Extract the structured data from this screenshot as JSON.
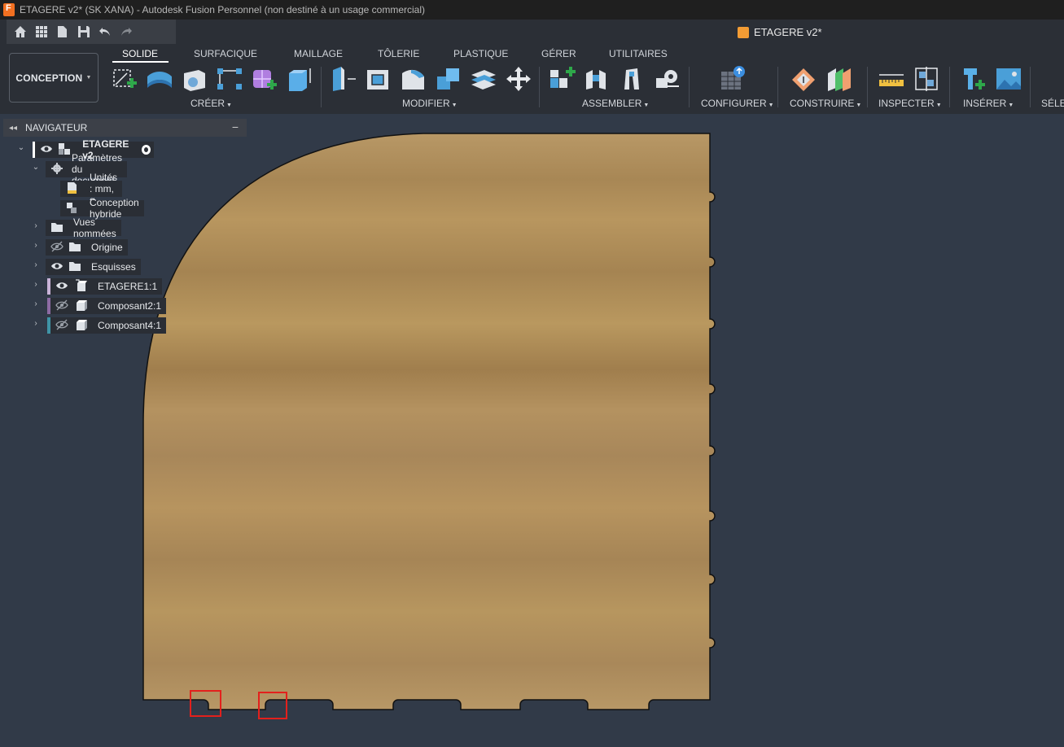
{
  "window": {
    "title": "ETAGERE v2* (SK XANA) - Autodesk Fusion Personnel (non destiné à un usage commercial)"
  },
  "document_tab": {
    "title": "ETAGERE v2*",
    "icon": "orange-cube-icon"
  },
  "workspace": {
    "label": "CONCEPTION"
  },
  "ribbon": {
    "tabs": [
      "SOLIDE",
      "SURFACIQUE",
      "MAILLAGE",
      "TÔLERIE",
      "PLASTIQUE",
      "GÉRER",
      "UTILITAIRES"
    ],
    "active_tab": "SOLIDE",
    "groups": [
      "CRÉER",
      "MODIFIER",
      "ASSEMBLER",
      "CONFIGURER",
      "CONSTRUIRE",
      "INSPECTER",
      "INSÉRER",
      "SÉLE"
    ]
  },
  "navigator": {
    "title": "NAVIGATEUR",
    "root": "ETAGERE v2",
    "items": [
      {
        "label": "Paramètres du document"
      },
      {
        "label": "Unités : mm, g"
      },
      {
        "label": "Conception hybride"
      },
      {
        "label": "Vues nommées"
      },
      {
        "label": "Origine"
      },
      {
        "label": "Esquisses"
      },
      {
        "label": "ETAGERE1:1"
      },
      {
        "label": "Composant2:1"
      },
      {
        "label": "Composant4:1"
      }
    ]
  },
  "colors": {
    "background": "#313a48",
    "wood": "#b5935f",
    "selection": "#e3201c",
    "component_bars": [
      "#c9b3d8",
      "#8d6ba4",
      "#3f94a6"
    ]
  }
}
